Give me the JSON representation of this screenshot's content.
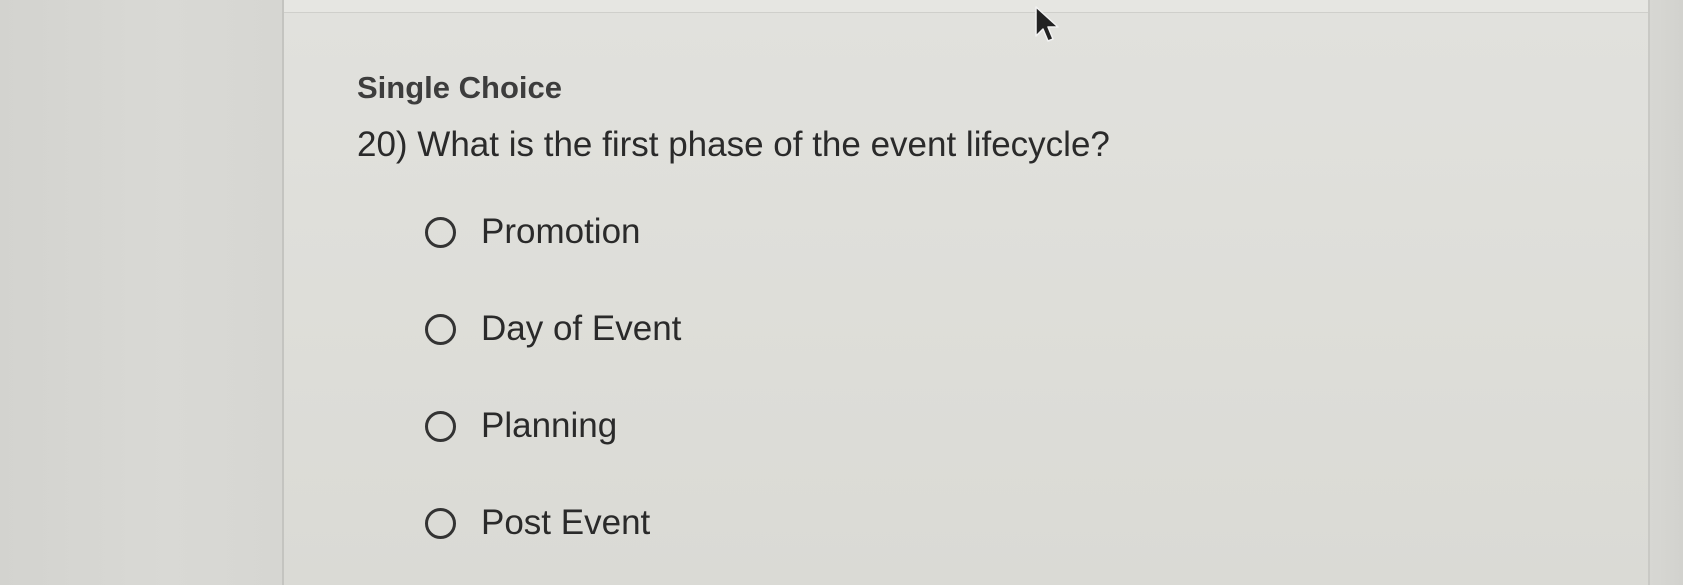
{
  "quiz": {
    "section_title": "Single Choice",
    "question": "20) What is the first phase of the event lifecycle?",
    "options": [
      {
        "label": "Promotion",
        "selected": false
      },
      {
        "label": "Day of Event",
        "selected": false
      },
      {
        "label": "Planning",
        "selected": false
      },
      {
        "label": "Post Event",
        "selected": false
      }
    ]
  },
  "icons": {
    "cursor": "mouse-pointer-icon",
    "radio": "radio-unselected-icon"
  },
  "colors": {
    "text": "#2a2a2a",
    "background": "#dedeD9"
  }
}
